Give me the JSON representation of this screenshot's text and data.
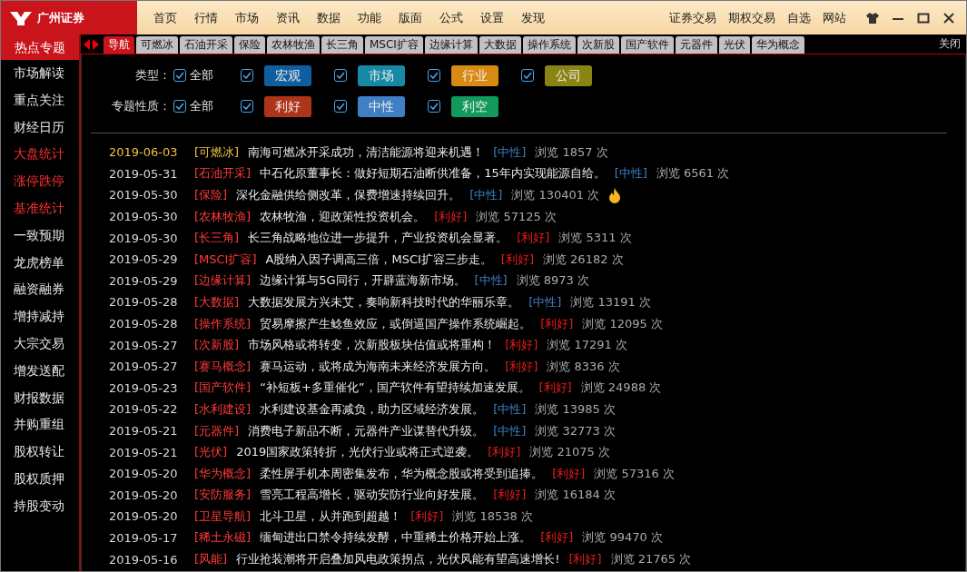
{
  "app": {
    "brand": "广州证券"
  },
  "menu": [
    "首页",
    "行情",
    "市场",
    "资讯",
    "数据",
    "功能",
    "版面",
    "公式",
    "设置",
    "发现"
  ],
  "links": [
    "证券交易",
    "期权交易",
    "自选",
    "网站"
  ],
  "sidebar": {
    "title": "热点专题",
    "items": [
      {
        "label": "市场解读",
        "emphasis": false
      },
      {
        "label": "重点关注",
        "emphasis": false
      },
      {
        "label": "财经日历",
        "emphasis": false
      },
      {
        "label": "大盘统计",
        "emphasis": true
      },
      {
        "label": "涨停跌停",
        "emphasis": true
      },
      {
        "label": "基准统计",
        "emphasis": true
      },
      {
        "label": "一致预期",
        "emphasis": false
      },
      {
        "label": "龙虎榜单",
        "emphasis": false
      },
      {
        "label": "融资融券",
        "emphasis": false
      },
      {
        "label": "增持减持",
        "emphasis": false
      },
      {
        "label": "大宗交易",
        "emphasis": false
      },
      {
        "label": "增发送配",
        "emphasis": false
      },
      {
        "label": "财报数据",
        "emphasis": false
      },
      {
        "label": "并购重组",
        "emphasis": false
      },
      {
        "label": "股权转让",
        "emphasis": false
      },
      {
        "label": "股权质押",
        "emphasis": false
      },
      {
        "label": "持股变动",
        "emphasis": false
      }
    ]
  },
  "tabs": [
    {
      "label": "导航",
      "selected": true
    },
    {
      "label": "可燃冰",
      "selected": false
    },
    {
      "label": "石油开采",
      "selected": false
    },
    {
      "label": "保险",
      "selected": false
    },
    {
      "label": "农林牧渔",
      "selected": false
    },
    {
      "label": "长三角",
      "selected": false
    },
    {
      "label": "MSCI扩容",
      "selected": false
    },
    {
      "label": "边缘计算",
      "selected": false
    },
    {
      "label": "大数据",
      "selected": false
    },
    {
      "label": "操作系统",
      "selected": false
    },
    {
      "label": "次新股",
      "selected": false
    },
    {
      "label": "国产软件",
      "selected": false
    },
    {
      "label": "元器件",
      "selected": false
    },
    {
      "label": "光伏",
      "selected": false
    },
    {
      "label": "华为概念",
      "selected": false
    }
  ],
  "close_label": "关闭",
  "filters": [
    {
      "label": "类型：",
      "all": {
        "label": "全部",
        "checked": true
      },
      "options": [
        {
          "label": "宏观",
          "checked": true,
          "color": "#0f5fa0"
        },
        {
          "label": "市场",
          "checked": true,
          "color": "#168aa4"
        },
        {
          "label": "行业",
          "checked": true,
          "color": "#d98a12"
        },
        {
          "label": "公司",
          "checked": true,
          "color": "#8a8414"
        }
      ]
    },
    {
      "label": "专题性质：",
      "all": {
        "label": "全部",
        "checked": true
      },
      "options": [
        {
          "label": "利好",
          "checked": true,
          "color": "#b03418"
        },
        {
          "label": "中性",
          "checked": true,
          "color": "#3f7fc4"
        },
        {
          "label": "利空",
          "checked": true,
          "color": "#129a5c"
        }
      ]
    }
  ],
  "rows": [
    {
      "date": "2019-06-03",
      "topic": "[可燃冰]",
      "headline": "南海可燃冰开采成功，清洁能源将迎来机遇！",
      "sentiment": {
        "label": "[中性]",
        "color": "#3f7fc4"
      },
      "views": "浏览 1857 次",
      "highlighted": true,
      "hot": false
    },
    {
      "date": "2019-05-31",
      "topic": "[石油开采]",
      "headline": "中石化原董事长：做好短期石油断供准备，15年内实现能源自给。",
      "sentiment": {
        "label": "[中性]",
        "color": "#3f7fc4"
      },
      "views": "浏览 6561 次",
      "highlighted": false,
      "hot": false
    },
    {
      "date": "2019-05-30",
      "topic": "[保险]",
      "headline": "深化金融供给侧改革，保费增速持续回升。",
      "sentiment": {
        "label": "[中性]",
        "color": "#3f7fc4"
      },
      "views": "浏览 130401 次",
      "highlighted": false,
      "hot": true
    },
    {
      "date": "2019-05-30",
      "topic": "[农林牧渔]",
      "headline": "农林牧渔，迎政策性投资机会。",
      "sentiment": {
        "label": "[利好]",
        "color": "#e81c1c"
      },
      "views": "浏览 57125 次",
      "highlighted": false,
      "hot": false
    },
    {
      "date": "2019-05-30",
      "topic": "[长三角]",
      "headline": "长三角战略地位进一步提升，产业投资机会显著。",
      "sentiment": {
        "label": "[利好]",
        "color": "#e81c1c"
      },
      "views": "浏览 5311 次",
      "highlighted": false,
      "hot": false
    },
    {
      "date": "2019-05-29",
      "topic": "[MSCI扩容]",
      "headline": "A股纳入因子调高三倍，MSCI扩容三步走。",
      "sentiment": {
        "label": "[利好]",
        "color": "#e81c1c"
      },
      "views": "浏览 26182 次",
      "highlighted": false,
      "hot": false
    },
    {
      "date": "2019-05-29",
      "topic": "[边缘计算]",
      "headline": "边缘计算与5G同行，开辟蓝海新市场。",
      "sentiment": {
        "label": "[中性]",
        "color": "#3f7fc4"
      },
      "views": "浏览 8973 次",
      "highlighted": false,
      "hot": false
    },
    {
      "date": "2019-05-28",
      "topic": "[大数据]",
      "headline": "大数据发展方兴未艾，奏响新科技时代的华丽乐章。",
      "sentiment": {
        "label": "[中性]",
        "color": "#3f7fc4"
      },
      "views": "浏览 13191 次",
      "highlighted": false,
      "hot": false
    },
    {
      "date": "2019-05-28",
      "topic": "[操作系统]",
      "headline": "贸易摩擦产生鲶鱼效应，或倒逼国产操作系统崛起。",
      "sentiment": {
        "label": "[利好]",
        "color": "#e81c1c"
      },
      "views": "浏览 12095 次",
      "highlighted": false,
      "hot": false
    },
    {
      "date": "2019-05-27",
      "topic": "[次新股]",
      "headline": "市场风格或将转变，次新股板块估值或将重构！",
      "sentiment": {
        "label": "[利好]",
        "color": "#e81c1c"
      },
      "views": "浏览 17291 次",
      "highlighted": false,
      "hot": false
    },
    {
      "date": "2019-05-27",
      "topic": "[赛马概念]",
      "headline": "赛马运动，或将成为海南未来经济发展方向。",
      "sentiment": {
        "label": "[利好]",
        "color": "#e81c1c"
      },
      "views": "浏览 8336 次",
      "highlighted": false,
      "hot": false
    },
    {
      "date": "2019-05-23",
      "topic": "[国产软件]",
      "headline": "“补短板+多重催化”，国产软件有望持续加速发展。",
      "sentiment": {
        "label": "[利好]",
        "color": "#e81c1c"
      },
      "views": "浏览 24988 次",
      "highlighted": false,
      "hot": false
    },
    {
      "date": "2019-05-22",
      "topic": "[水利建设]",
      "headline": "水利建设基金再减负，助力区域经济发展。",
      "sentiment": {
        "label": "[中性]",
        "color": "#3f7fc4"
      },
      "views": "浏览 13985 次",
      "highlighted": false,
      "hot": false
    },
    {
      "date": "2019-05-21",
      "topic": "[元器件]",
      "headline": "消费电子新品不断，元器件产业谋替代升级。",
      "sentiment": {
        "label": "[中性]",
        "color": "#3f7fc4"
      },
      "views": "浏览 32773 次",
      "highlighted": false,
      "hot": false
    },
    {
      "date": "2019-05-21",
      "topic": "[光伏]",
      "headline": "2019国家政策转折，光伏行业或将正式逆袭。",
      "sentiment": {
        "label": "[利好]",
        "color": "#e81c1c"
      },
      "views": "浏览 21075 次",
      "highlighted": false,
      "hot": false
    },
    {
      "date": "2019-05-20",
      "topic": "[华为概念]",
      "headline": "柔性屏手机本周密集发布，华为概念股或将受到追捧。",
      "sentiment": {
        "label": "[利好]",
        "color": "#e81c1c"
      },
      "views": "浏览 57316 次",
      "highlighted": false,
      "hot": false
    },
    {
      "date": "2019-05-20",
      "topic": "[安防服务]",
      "headline": "雪亮工程高增长，驱动安防行业向好发展。",
      "sentiment": {
        "label": "[利好]",
        "color": "#e81c1c"
      },
      "views": "浏览 16184 次",
      "highlighted": false,
      "hot": false
    },
    {
      "date": "2019-05-20",
      "topic": "[卫星导航]",
      "headline": "北斗卫星，从并跑到超越！",
      "sentiment": {
        "label": "[利好]",
        "color": "#e81c1c"
      },
      "views": "浏览 18538 次",
      "highlighted": false,
      "hot": false
    },
    {
      "date": "2019-05-17",
      "topic": "[稀土永磁]",
      "headline": "缅甸进出口禁令持续发酵，中重稀土价格开始上涨。",
      "sentiment": {
        "label": "[利好]",
        "color": "#e81c1c"
      },
      "views": "浏览 99470 次",
      "highlighted": false,
      "hot": false
    },
    {
      "date": "2019-05-16",
      "topic": "[风能]",
      "headline": "行业抢装潮将开启叠加风电政策拐点，光伏风能有望高速增长!",
      "sentiment": {
        "label": "[利好]",
        "color": "#e81c1c"
      },
      "views": "浏览 21765 次",
      "highlighted": false,
      "hot": false
    }
  ]
}
